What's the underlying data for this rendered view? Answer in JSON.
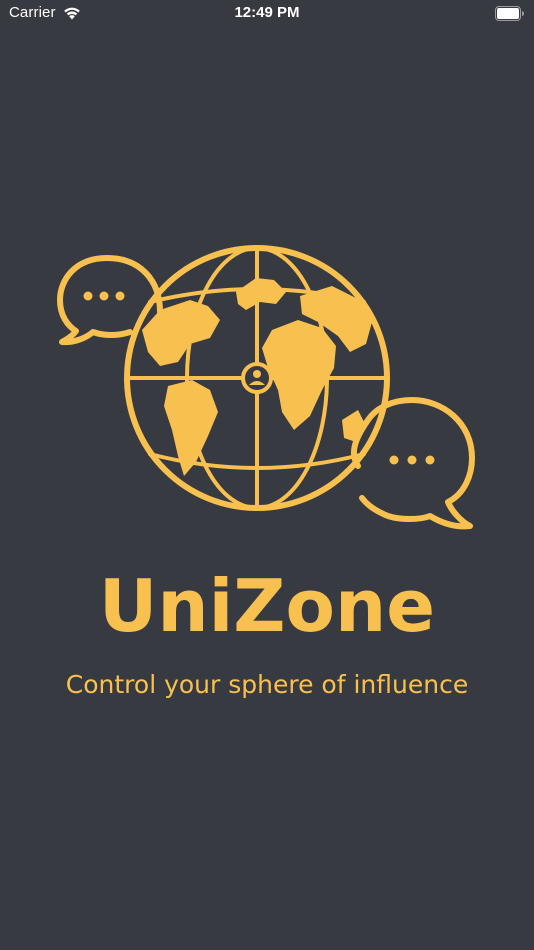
{
  "status_bar": {
    "carrier": "Carrier",
    "time": "12:49 PM",
    "wifi_icon": "wifi-icon",
    "battery_icon": "battery-icon"
  },
  "splash": {
    "title": "UniZone",
    "tagline": "Control your sphere of influence",
    "logo_icon": "globe-chat-logo-icon"
  },
  "colors": {
    "background": "#383a41",
    "accent": "#f8c14f",
    "status_text": "#ffffff"
  }
}
